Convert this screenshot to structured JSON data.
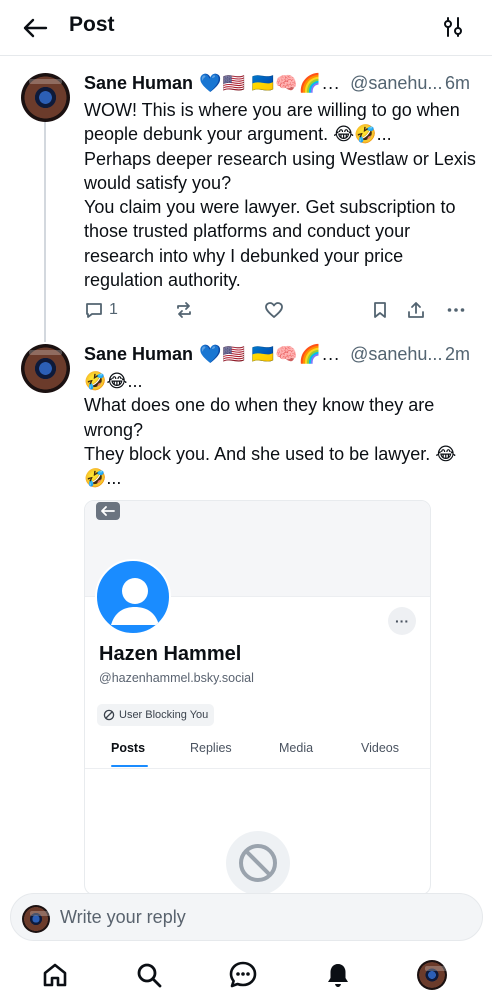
{
  "header": {
    "title": "Post",
    "back_icon": "arrow-left-icon",
    "filter_icon": "sliders-icon"
  },
  "posts": [
    {
      "author": "Sane Human",
      "flags": "💙🇺🇸 🇺🇦🧠🌈...",
      "handle": "@sanehu...",
      "time": "6m",
      "body": "WOW! This is where you are willing to go when people debunk your argument. 😂🤣...\nPerhaps deeper research using Westlaw or Lexis would satisfy you?\nYou claim you were lawyer. Get subscription to those trusted platforms and conduct your research into why I debunked your price regulation authority.",
      "reply_count": "1"
    },
    {
      "author": "Sane Human",
      "flags": "💙🇺🇸 🇺🇦🧠🌈...",
      "handle": "@sanehu...",
      "time": "2m",
      "body": "🤣😂...\nWhat does one do when they know they are wrong?\nThey block you. And she used to be lawyer. 😂🤣..."
    }
  ],
  "embed": {
    "name": "Hazen Hammel",
    "handle": "@hazenhammel.bsky.social",
    "badge": "User Blocking You",
    "more": "···",
    "tabs": [
      "Posts",
      "Replies",
      "Media",
      "Videos"
    ],
    "accent": "#1a8cff"
  },
  "reply": {
    "placeholder": "Write your reply"
  },
  "nav": [
    "home-icon",
    "search-icon",
    "chat-icon",
    "notifications-bell-icon",
    "profile-avatar"
  ]
}
